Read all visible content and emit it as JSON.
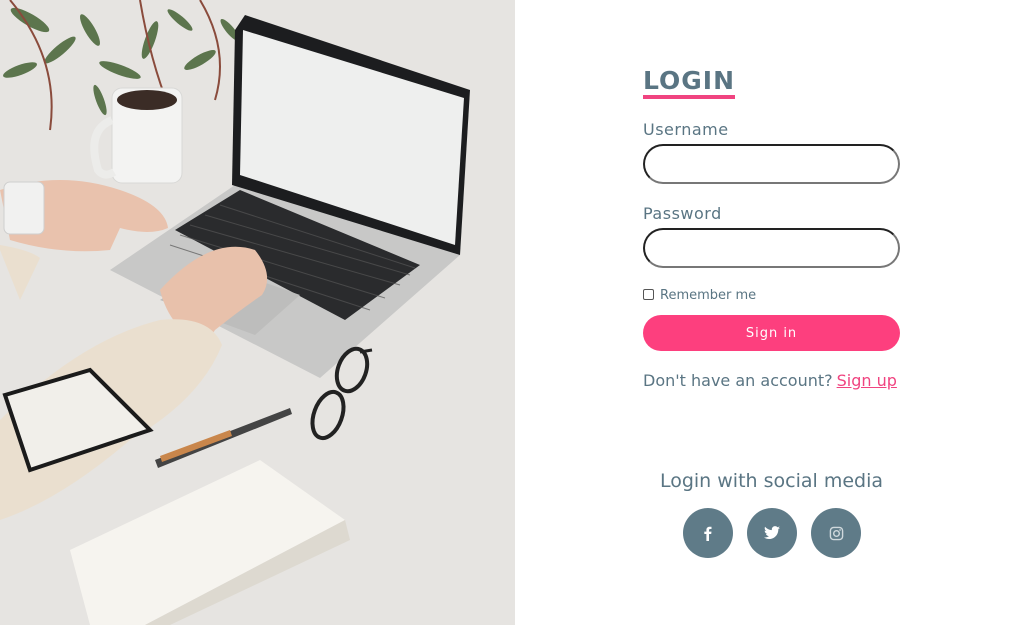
{
  "login": {
    "title": "LOGIN",
    "username_label": "Username",
    "username_value": "",
    "password_label": "Password",
    "password_value": "",
    "remember_label": "Remember me",
    "remember_checked": false,
    "signin_label": "Sign in",
    "no_account_text": "Don't have an account?",
    "signup_link": "Sign up"
  },
  "social": {
    "title": "Login with social media",
    "buttons": [
      "facebook-icon",
      "twitter-icon",
      "instagram-icon"
    ]
  },
  "colors": {
    "accent": "#fd3f7e",
    "text": "#5a7583",
    "social_bg": "#5f7b88"
  }
}
